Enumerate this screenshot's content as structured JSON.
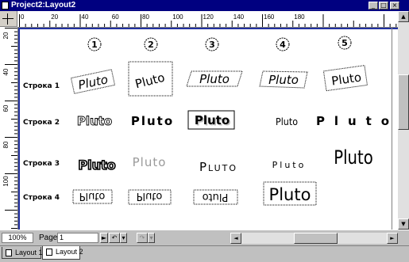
{
  "window": {
    "title": "Project2:Layout2",
    "minimize_icon": "_",
    "maximize_icon": "□",
    "close_icon": "×"
  },
  "rulers": {
    "horizontal_labels": [
      "0",
      "20",
      "40",
      "60",
      "80",
      "100",
      "120",
      "140",
      "160",
      "180"
    ],
    "vertical_labels": [
      "20",
      "40",
      "60",
      "80",
      "100"
    ]
  },
  "columns": [
    "1",
    "2",
    "3",
    "4",
    "5"
  ],
  "rows": [
    {
      "label": "Строка 1"
    },
    {
      "label": "Строка 2"
    },
    {
      "label": "Строка 3"
    },
    {
      "label": "Строка 4"
    }
  ],
  "sample_text": "Pluto",
  "status": {
    "zoom": "100%",
    "page_label": "Page:",
    "page_value": "1",
    "next_icon": "►",
    "undo_icon": "↶",
    "dropdown_icon": "▾",
    "redo_icon": "↷"
  },
  "tabs": [
    {
      "label": "Layout 1"
    },
    {
      "label": "Layout 2"
    }
  ]
}
